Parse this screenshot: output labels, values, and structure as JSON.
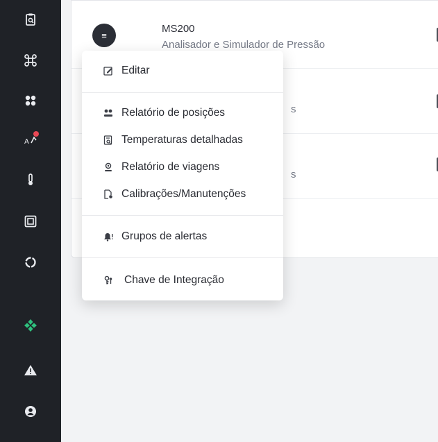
{
  "sidebar": {
    "icons": [
      "clipboard-search-icon",
      "command-icon",
      "gear-cluster-icon",
      "transfer-icon",
      "thermometer-icon",
      "square-frame-icon",
      "ring-icon",
      "green-diamond-icon",
      "warning-icon",
      "user-icon"
    ],
    "accent_color": "#2ec27e",
    "notification_color": "#e74855"
  },
  "devices": [
    {
      "name": "MS200",
      "description": "Analisador e Simulador de Pressão"
    },
    {
      "description_visible_suffix": "s"
    },
    {
      "description_visible_suffix": "s"
    }
  ],
  "menu": {
    "button_glyph": "≡",
    "items": [
      {
        "label": "Editar",
        "icon": "edit-icon"
      },
      {
        "label": "Relatório de posições",
        "icon": "position-report-icon"
      },
      {
        "label": "Temperaturas detalhadas",
        "icon": "temperature-detail-icon"
      },
      {
        "label": "Relatório de viagens",
        "icon": "trip-report-icon"
      },
      {
        "label": "Calibrações/Manutenções",
        "icon": "calibration-icon"
      },
      {
        "label": "Grupos de alertas",
        "icon": "alert-bell-icon"
      },
      {
        "label": "Chave de Integração",
        "icon": "integration-key-icon"
      }
    ]
  }
}
